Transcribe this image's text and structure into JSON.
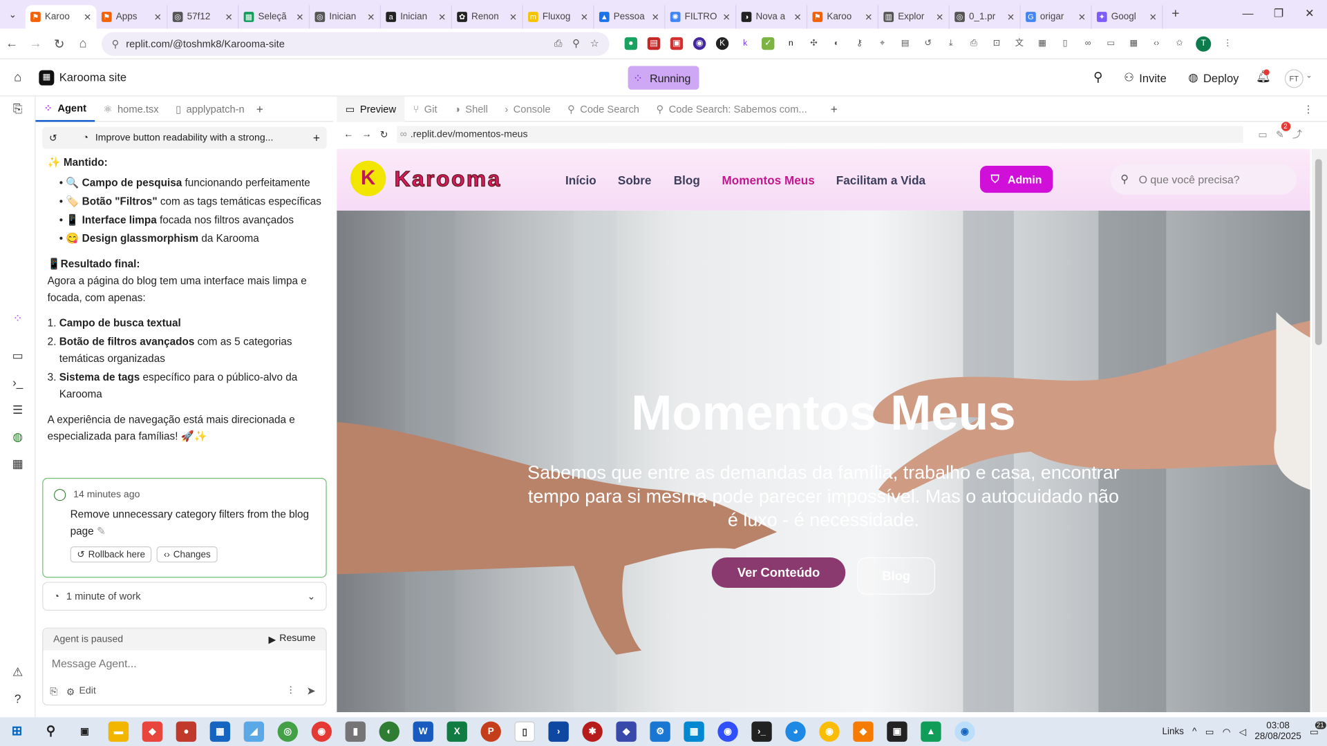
{
  "browser": {
    "tabs": [
      {
        "label": "Karoo",
        "color": "#f26207",
        "glyph": "⚑",
        "active": true
      },
      {
        "label": "Apps",
        "color": "#f26207",
        "glyph": "⚑"
      },
      {
        "label": "57f12",
        "color": "#555555",
        "glyph": "◎"
      },
      {
        "label": "Seleçã",
        "color": "#0f9d58",
        "glyph": "▦"
      },
      {
        "label": "Inician",
        "color": "#555555",
        "glyph": "◎"
      },
      {
        "label": "Inician",
        "color": "#222222",
        "glyph": "a"
      },
      {
        "label": "Renon",
        "color": "#222222",
        "glyph": "✿"
      },
      {
        "label": "Fluxog",
        "color": "#f5c400",
        "glyph": "m"
      },
      {
        "label": "Pessoa",
        "color": "#1a73e8",
        "glyph": "▲"
      },
      {
        "label": "FILTRO",
        "color": "#4285f4",
        "glyph": "✺"
      },
      {
        "label": "Nova a",
        "color": "#222222",
        "glyph": "◑"
      },
      {
        "label": "Karoo",
        "color": "#f26207",
        "glyph": "⚑"
      },
      {
        "label": "Explor",
        "color": "#555555",
        "glyph": "▥"
      },
      {
        "label": "0_1.pr",
        "color": "#555555",
        "glyph": "◎"
      },
      {
        "label": "origar",
        "color": "#4285f4",
        "glyph": "G"
      },
      {
        "label": "Googl",
        "color": "#7c5cff",
        "glyph": "✦"
      }
    ],
    "url": "replit.com/@toshmk8/Karooma-site",
    "profile_initial": "T"
  },
  "replit": {
    "project_name": "Karooma site",
    "run_status": "Running",
    "invite_label": "Invite",
    "deploy_label": "Deploy",
    "avatar": "FT",
    "notif_count": "2",
    "panel_tabs": [
      "Agent",
      "home.tsx",
      "applypatch-n"
    ],
    "history_title": "Improve button readability with a strong...",
    "right_tabs": [
      "Preview",
      "Git",
      "Shell",
      "Console",
      "Code Search",
      "Code Search: Sabemos com..."
    ],
    "preview_url": ".replit.dev/momentos-meus"
  },
  "chat": {
    "kept_title": "Mantido:",
    "kept": [
      {
        "emoji": "🔍",
        "bold": "Campo de pesquisa",
        "rest": " funcionando perfeitamente"
      },
      {
        "emoji": "🏷️",
        "bold": "Botão \"Filtros\"",
        "rest": " com as tags temáticas específicas"
      },
      {
        "emoji": "📱",
        "bold": "Interface limpa",
        "rest": " focada nos filtros avançados"
      },
      {
        "emoji": "😋",
        "bold": "Design glassmorphism",
        "rest": " da Karooma"
      }
    ],
    "result_title": "Resultado final:",
    "result_text": "Agora a página do blog tem uma interface mais limpa e focada, com apenas:",
    "numbered": [
      {
        "bold": "Campo de busca textual",
        "rest": ""
      },
      {
        "bold": "Botão de filtros avançados",
        "rest": " com as 5 categorias temáticas organizadas"
      },
      {
        "bold": "Sistema de tags",
        "rest": " específico para o público-alvo da Karooma"
      }
    ],
    "closing": "A experiência de navegação está mais direcionada e especializada para famílias! 🚀✨",
    "checkpoint": {
      "time": "14 minutes ago",
      "text": "Remove unnecessary category filters from the blog page",
      "rollback": "Rollback here",
      "changes": "Changes"
    },
    "work": "1 minute of work",
    "paused": "Agent is paused",
    "resume": "Resume",
    "input_placeholder": "Message Agent...",
    "edit": "Edit"
  },
  "site": {
    "logo": "Karooma",
    "nav": [
      "Início",
      "Sobre",
      "Blog",
      "Momentos Meus",
      "Facilitam a Vida"
    ],
    "active_nav": "Momentos Meus",
    "admin": "Admin",
    "search_placeholder": "O que você precisa?",
    "hero_title": "Momentos Meus",
    "hero_sub": "Sabemos que entre as demandas da família, trabalho e casa, encontrar tempo para si mesma pode parecer impossível. Mas o autocuidado não é luxo - é necessidade.",
    "btn_primary": "Ver Conteúdo",
    "btn_secondary": "Blog"
  },
  "taskbar": {
    "links": "Links",
    "time": "03:08",
    "date": "28/08/2025",
    "notif": "21"
  }
}
